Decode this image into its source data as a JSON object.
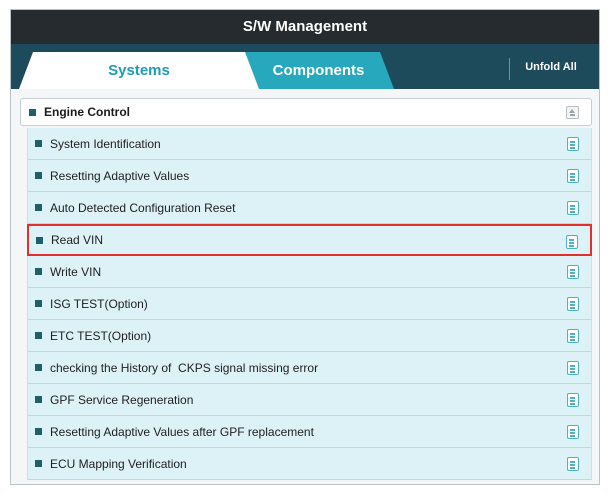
{
  "window": {
    "title": "S/W Management"
  },
  "tabs": [
    {
      "label": "Systems",
      "active": true
    },
    {
      "label": "Components",
      "active": false
    }
  ],
  "toolbar": {
    "unfold_label": "Unfold All"
  },
  "section": {
    "title": "Engine Control",
    "items": [
      {
        "label": "System Identification"
      },
      {
        "label": "Resetting Adaptive Values"
      },
      {
        "label": "Auto Detected Configuration Reset"
      },
      {
        "label": "Read VIN",
        "selected": true
      },
      {
        "label": "Write VIN"
      },
      {
        "label": "ISG TEST(Option)"
      },
      {
        "label": "ETC TEST(Option)"
      },
      {
        "label": "checking the History of  CKPS signal missing error"
      },
      {
        "label": "GPF Service Regeneration"
      },
      {
        "label": "Resetting Adaptive Values after GPF replacement"
      },
      {
        "label": "ECU Mapping Verification"
      }
    ]
  },
  "colors": {
    "title_bar": "#252b2e",
    "tab_bar": "#1d4b5c",
    "active_tab_text": "#1d9cb3",
    "inactive_tab": "#27a8bd",
    "row_background": "#ddf2f6",
    "selection_border": "#e0302b"
  },
  "icons": {
    "header_toggle": "collapse-icon",
    "row_action": "document-icon"
  }
}
